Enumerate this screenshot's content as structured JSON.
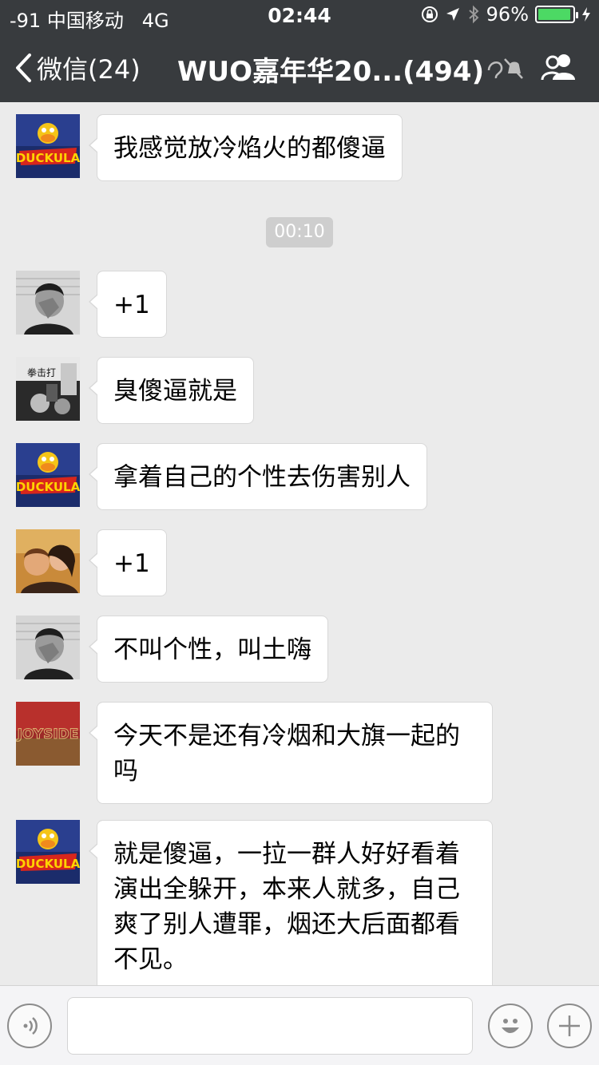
{
  "status_bar": {
    "carrier": "-91 中国移动   4G",
    "time": "02:44",
    "battery_pct": "96%",
    "battery_level": 0.96
  },
  "nav": {
    "back_label": "微信(24)",
    "title": "WUO嘉年华20...(494)"
  },
  "time_divider": "00:10",
  "messages": [
    {
      "avatar": "duckula-avatar",
      "text": "我感觉放冷焰火的都傻逼"
    },
    {
      "avatar": "face-palm-avatar",
      "text": "+1"
    },
    {
      "avatar": "band-photo-avatar",
      "text": "臭傻逼就是"
    },
    {
      "avatar": "duckula-avatar",
      "text": "拿着自己的个性去伤害别人"
    },
    {
      "avatar": "couple-photo-avatar",
      "text": "+1"
    },
    {
      "avatar": "face-palm-avatar",
      "text": "不叫个性，叫土嗨"
    },
    {
      "avatar": "joyside-avatar",
      "text": "今天不是还有冷烟和大旗一起的吗"
    },
    {
      "avatar": "duckula-avatar",
      "text": "就是傻逼，一拉一群人好好看着演出全躲开，本来人就多，自己爽了别人遭罪，烟还大后面都看不见。"
    }
  ],
  "colors": {
    "nav_bg": "#383b3e",
    "chat_bg": "#ebebeb",
    "battery_green": "#4cd964"
  }
}
